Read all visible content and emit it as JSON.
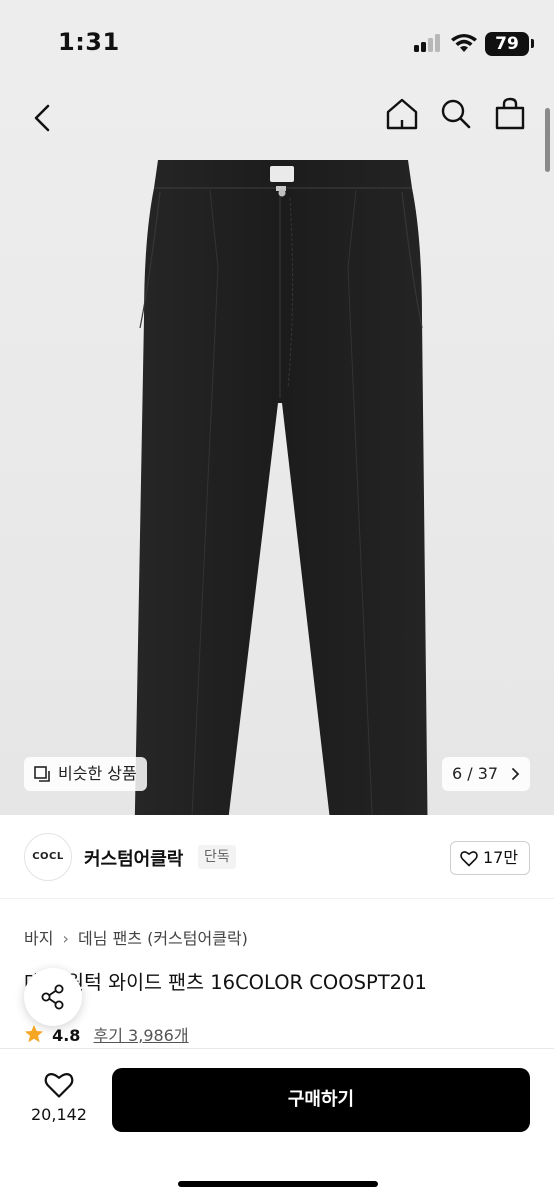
{
  "status_bar": {
    "time": "1:31",
    "battery": "79"
  },
  "nav": {
    "back_icon": "chevron-left-icon",
    "home_icon": "home-icon",
    "search_icon": "search-icon",
    "cart_icon": "shopping-bag-icon"
  },
  "hero": {
    "image_subject": "black denim wide pants",
    "similar_label": "비슷한 상품",
    "pager": "6 / 37"
  },
  "brand": {
    "logo_text": "COCL",
    "name": "커스텀어클락",
    "badge": "단독",
    "likes": "17만"
  },
  "product": {
    "breadcrumb": [
      "바지",
      "데님 팬츠 (커스텀어클락)"
    ],
    "title": "데님 원턱 와이드 팬츠 16COLOR COOSPT201",
    "rating": "4.8",
    "review_link": "후기 3,986개"
  },
  "bottom_bar": {
    "favorite_count": "20,142",
    "buy_label": "구매하기"
  },
  "colors": {
    "accent_star": "#f5a623",
    "buy_button": "#000000",
    "hero_bg": "#ededed"
  }
}
